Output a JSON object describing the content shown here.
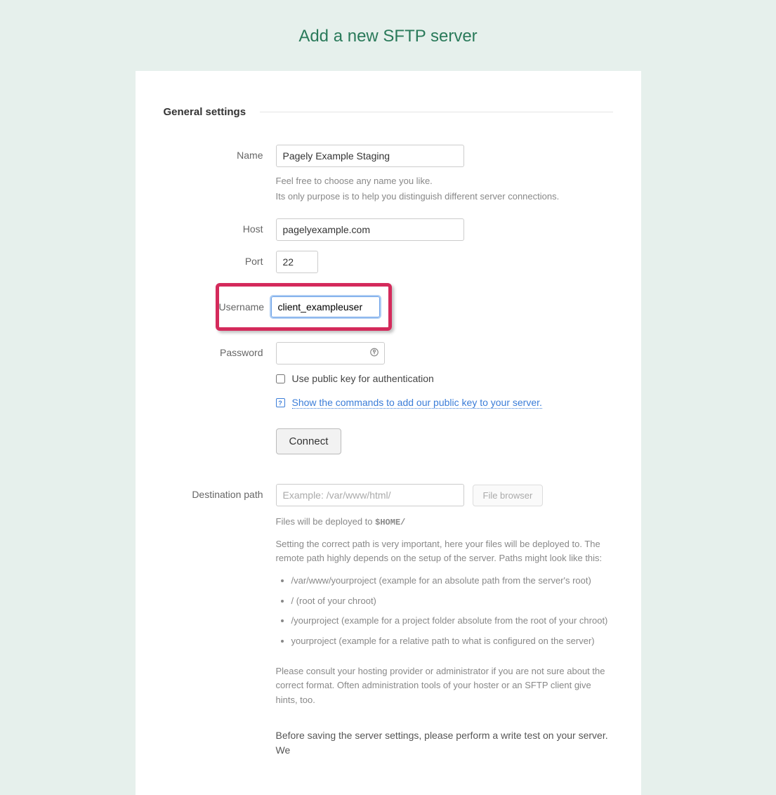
{
  "page_title": "Add a new SFTP server",
  "section_title": "General settings",
  "fields": {
    "name": {
      "label": "Name",
      "value": "Pagely Example Staging",
      "help1": "Feel free to choose any name you like.",
      "help2": "Its only purpose is to help you distinguish different server connections."
    },
    "host": {
      "label": "Host",
      "value": "pagelyexample.com"
    },
    "port": {
      "label": "Port",
      "value": "22"
    },
    "username": {
      "label": "Username",
      "value": "client_exampleuser"
    },
    "password": {
      "label": "Password",
      "value": ""
    },
    "pubkey_label": "Use public key for authentication",
    "show_commands_label": "Show the commands to add our public key to your server.",
    "connect_label": "Connect",
    "dest": {
      "label": "Destination path",
      "placeholder": "Example: /var/www/html/",
      "browser_btn": "File browser",
      "deploy_prefix": "Files will be deployed to ",
      "deploy_code": "$HOME/",
      "desc": "Setting the correct path is very important, here your files will be deployed to. The remote path highly depends on the setup of the server. Paths might look like this:",
      "examples": [
        "/var/www/yourproject (example for an absolute path from the server's root)",
        "/ (root of your chroot)",
        "/yourproject (example for a project folder absolute from the root of your chroot)",
        "yourproject (example for a relative path to what is configured on the server)"
      ],
      "consult": "Please consult your hosting provider or administrator if you are not sure about the correct format. Often administration tools of your hoster or an SFTP client give hints, too.",
      "final": "Before saving the server settings, please perform a write test on your server. We"
    }
  }
}
